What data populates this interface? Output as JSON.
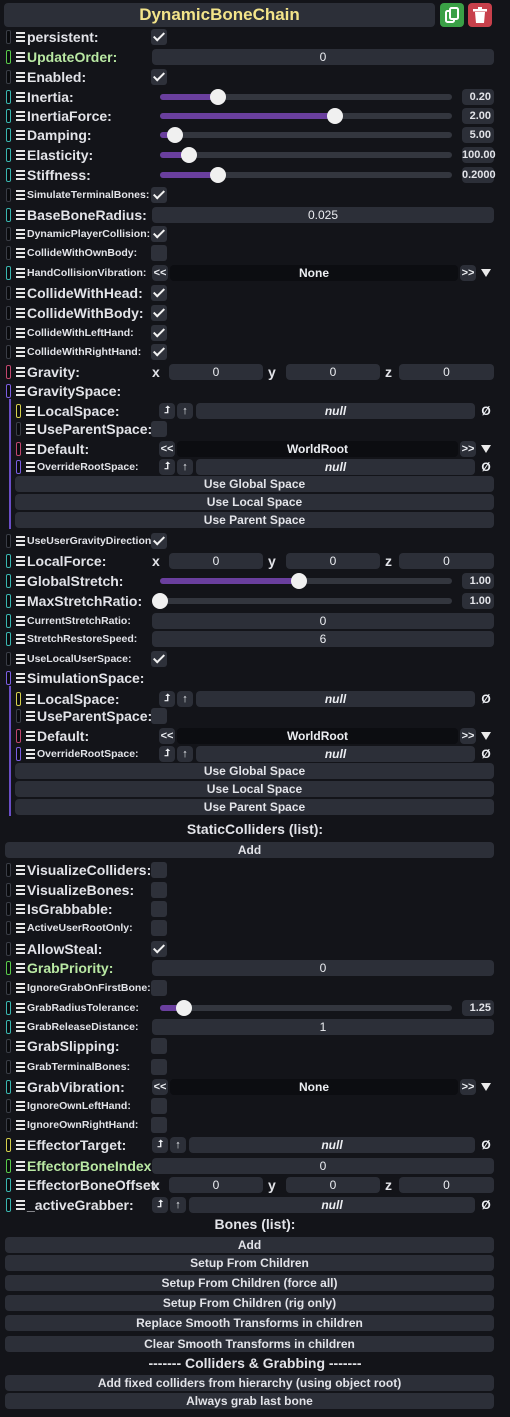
{
  "title": "DynamicBoneChain",
  "icons": {
    "duplicate": "duplicate-icon",
    "delete": "trash-icon"
  },
  "colors": {
    "accent": "#6a3f9e",
    "title": "#f3e48a",
    "bg": "#131419"
  },
  "labels": {
    "persistent": "persistent:",
    "updateOrder": "UpdateOrder:",
    "enabled": "Enabled:",
    "inertia": "Inertia:",
    "inertiaForce": "InertiaForce:",
    "damping": "Damping:",
    "elasticity": "Elasticity:",
    "stiffness": "Stiffness:",
    "simulateTerminalBones": "SimulateTerminalBones:",
    "baseBoneRadius": "BaseBoneRadius:",
    "dynamicPlayerCollision": "DynamicPlayerCollision:",
    "collideWithOwnBody": "CollideWithOwnBody:",
    "handCollisionVibration": "HandCollisionVibration:",
    "collideWithHead": "CollideWithHead:",
    "collideWithBody": "CollideWithBody:",
    "collideWithLeftHand": "CollideWithLeftHand:",
    "collideWithRightHand": "CollideWithRightHand:",
    "gravity": "Gravity:",
    "gravitySpace": "GravitySpace:",
    "localSpace": "LocalSpace:",
    "useParentSpace": "UseParentSpace:",
    "default": "Default:",
    "overrideRootSpace": "OverrideRootSpace:",
    "useUserGravityDirection": "UseUserGravityDirection:",
    "localForce": "LocalForce:",
    "globalStretch": "GlobalStretch:",
    "maxStretchRatio": "MaxStretchRatio:",
    "currentStretchRatio": "CurrentStretchRatio:",
    "stretchRestoreSpeed": "StretchRestoreSpeed:",
    "useLocalUserSpace": "UseLocalUserSpace:",
    "simulationSpace": "SimulationSpace:",
    "staticColliders": "StaticColliders (list):",
    "visualizeColliders": "VisualizeColliders:",
    "visualizeBones": "VisualizeBones:",
    "isGrabbable": "IsGrabbable:",
    "activeUserRootOnly": "ActiveUserRootOnly:",
    "allowSteal": "AllowSteal:",
    "grabPriority": "GrabPriority:",
    "ignoreGrabOnFirstBone": "IgnoreGrabOnFirstBone:",
    "grabRadiusTolerance": "GrabRadiusTolerance:",
    "grabReleaseDistance": "GrabReleaseDistance:",
    "grabSlipping": "GrabSlipping:",
    "grabTerminalBones": "GrabTerminalBones:",
    "grabVibration": "GrabVibration:",
    "ignoreOwnLeftHand": "IgnoreOwnLeftHand:",
    "ignoreOwnRightHand": "IgnoreOwnRightHand:",
    "effectorTarget": "EffectorTarget:",
    "effectorBoneIndex": "EffectorBoneIndex:",
    "effectorBoneOffset": "EffectorBoneOffset:",
    "activeGrabber": "_activeGrabber:",
    "bones": "Bones (list):"
  },
  "values": {
    "updateOrder": "0",
    "inertia": "0.20",
    "inertiaForce": "2.00",
    "damping": "5.00",
    "elasticity": "100.00",
    "stiffness": "0.2000",
    "baseBoneRadius": "0.025",
    "handCollisionVibration": "None",
    "gravity": {
      "x": "0",
      "y": "0",
      "z": "0"
    },
    "localSpace": "null",
    "default": "WorldRoot",
    "overrideRootSpace": "null",
    "localForce": {
      "x": "0",
      "y": "0",
      "z": "0"
    },
    "globalStretch": "1.00",
    "maxStretchRatio": "1.00",
    "currentStretchRatio": "0",
    "stretchRestoreSpeed": "6",
    "grabPriority": "0",
    "grabRadiusTolerance": "1.25",
    "grabReleaseDistance": "1",
    "grabVibration": "None",
    "effectorTarget": "null",
    "effectorBoneIndex": "0",
    "effectorBoneOffset": {
      "x": "0",
      "y": "0",
      "z": "0"
    },
    "activeGrabber": "null"
  },
  "sliders": {
    "inertia": 0.2,
    "inertiaForce": 0.6,
    "damping": 0.05,
    "elasticity": 0.1,
    "stiffness": 0.2,
    "globalStretch": 0.475,
    "maxStretchRatio": 0.0,
    "grabRadiusTolerance": 0.083
  },
  "axes": {
    "x": "x",
    "y": "y",
    "z": "z"
  },
  "glyphs": {
    "prev": "<<",
    "next": ">>",
    "clear": "Ø",
    "drop": "⮥",
    "up": "↑"
  },
  "buttons": {
    "useGlobalSpace": "Use Global Space",
    "useLocalSpace": "Use Local Space",
    "useParentSpace": "Use Parent Space",
    "add": "Add",
    "setupFromChildren": "Setup From Children",
    "setupFromChildrenForceAll": "Setup From Children (force all)",
    "setupFromChildrenRigOnly": "Setup From Children (rig only)",
    "replaceSmooth": "Replace Smooth Transforms in children",
    "clearSmooth": "Clear Smooth Transforms in children",
    "addFixedColliders": "Add fixed colliders from hierarchy (using object root)",
    "alwaysGrabLastBone": "Always grab last bone"
  },
  "collidersHeader": "------- Colliders & Grabbing -------"
}
